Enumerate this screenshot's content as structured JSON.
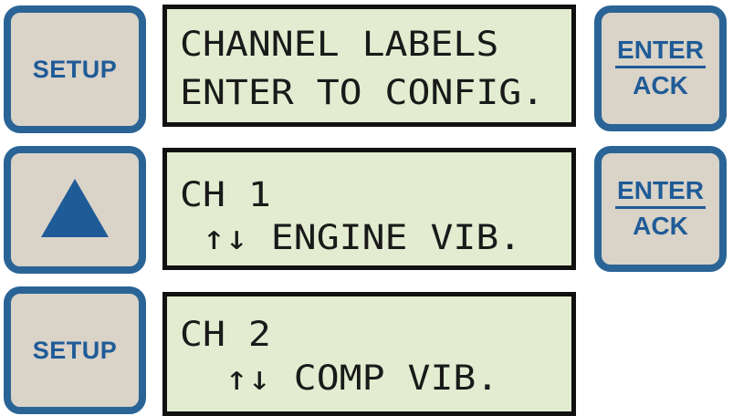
{
  "rows": [
    {
      "left_button": "SETUP",
      "lcd": {
        "line1": "CHANNEL LABELS",
        "line2": "ENTER TO CONFIG."
      },
      "right_button": {
        "top": "ENTER",
        "bottom": "ACK"
      }
    },
    {
      "left_button_icon": "up-triangle-icon",
      "lcd": {
        "line1": "CH 1",
        "line2": " ↑↓ ENGINE VIB."
      },
      "right_button": {
        "top": "ENTER",
        "bottom": "ACK"
      }
    },
    {
      "left_button": "SETUP",
      "lcd": {
        "line1": "CH 2",
        "line2": "  ↑↓ COMP VIB."
      }
    }
  ],
  "colors": {
    "button_border": "#2a6496",
    "button_face": "#d9d3c8",
    "button_text": "#1f5b97",
    "lcd_background": "#e3ecd0",
    "lcd_border": "#111111"
  }
}
